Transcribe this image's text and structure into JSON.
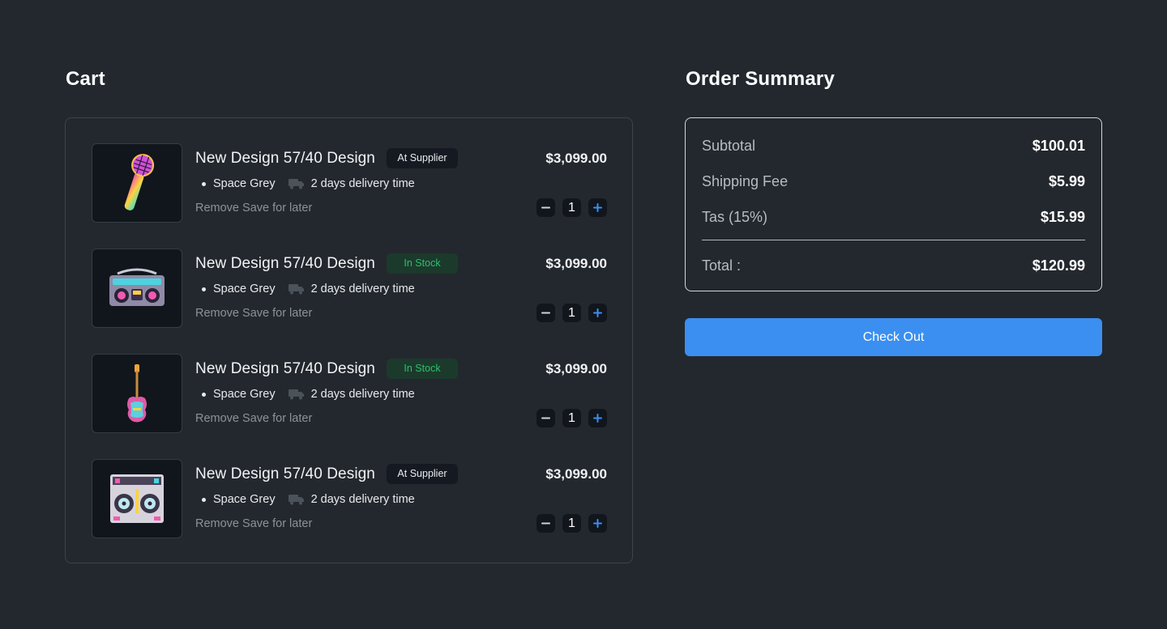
{
  "cart": {
    "title": "Cart",
    "items": [
      {
        "name": "New Design 57/40 Design",
        "badge": "At Supplier",
        "badge_type": "supplier",
        "color": "Space Grey",
        "delivery": "2 days delivery time",
        "remove_label": "Remove",
        "save_label": "Save for later",
        "price": "$3,099.00",
        "quantity": "1",
        "image_icon": "microphone-icon"
      },
      {
        "name": "New Design 57/40 Design",
        "badge": "In Stock",
        "badge_type": "stock",
        "color": "Space Grey",
        "delivery": "2 days delivery time",
        "remove_label": "Remove",
        "save_label": "Save for later",
        "price": "$3,099.00",
        "quantity": "1",
        "image_icon": "boombox-icon"
      },
      {
        "name": "New Design 57/40 Design",
        "badge": "In Stock",
        "badge_type": "stock",
        "color": "Space Grey",
        "delivery": "2 days delivery time",
        "remove_label": "Remove",
        "save_label": "Save for later",
        "price": "$3,099.00",
        "quantity": "1",
        "image_icon": "guitar-icon"
      },
      {
        "name": "New Design 57/40 Design",
        "badge": "At Supplier",
        "badge_type": "supplier",
        "color": "Space Grey",
        "delivery": "2 days delivery time",
        "remove_label": "Remove",
        "save_label": "Save for later",
        "price": "$3,099.00",
        "quantity": "1",
        "image_icon": "dj-controller-icon"
      }
    ]
  },
  "summary": {
    "title": "Order Summary",
    "subtotal_label": "Subtotal",
    "subtotal_value": "$100.01",
    "shipping_label": "Shipping Fee",
    "shipping_value": "$5.99",
    "tax_label": "Tas (15%)",
    "tax_value": "$15.99",
    "total_label": "Total :",
    "total_value": "$120.99",
    "checkout_label": "Check Out"
  },
  "colors": {
    "background": "#23282e",
    "accent": "#3b8ff0",
    "in_stock": "#2fbf6c"
  }
}
